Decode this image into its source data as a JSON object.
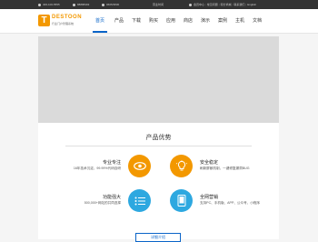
{
  "topbar": {
    "phone1": "400-100-5555",
    "phone2": "88888393",
    "phone3": "0605/3830",
    "hours": "营业时间",
    "links": [
      "会员中心",
      "常见问题",
      "积分商城",
      "联系我们",
      "English"
    ]
  },
  "logo": {
    "name": "DESTOON",
    "tagline": "行业门户管理系统"
  },
  "nav": {
    "items": [
      "首页",
      "产品",
      "下载",
      "购买",
      "应用",
      "商店",
      "演示",
      "案例",
      "主机",
      "文档"
    ],
    "active_index": 0
  },
  "section": {
    "title": "产品优势",
    "features": [
      {
        "title": "专业专注",
        "desc": "16年技术沉淀，99.99%代码自研",
        "color": "#f39800",
        "icon": "eye-icon"
      },
      {
        "title": "安全稳定",
        "desc": "刷新屏蔽机制，一键修复漏洞BUG",
        "color": "#f39800",
        "icon": "lightbulb-icon"
      },
      {
        "title": "功能强大",
        "desc": "500,000+网站的共同选择",
        "color": "#2da8e0",
        "icon": "list-icon"
      },
      {
        "title": "全网营销",
        "desc": "支持PC、手机版、APP、公众号、小程序",
        "color": "#2da8e0",
        "icon": "tablet-icon"
      }
    ],
    "more_label": "详细介绍"
  },
  "colors": {
    "accent_blue": "#0a64c8",
    "brand_orange": "#f39800",
    "feature_blue": "#2da8e0"
  }
}
